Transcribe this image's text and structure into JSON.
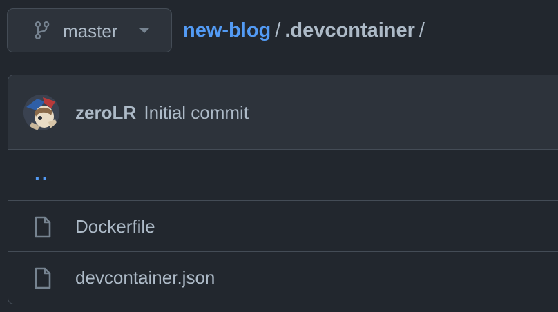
{
  "branch": {
    "label": "master",
    "icon": "git-branch-icon"
  },
  "breadcrumb": {
    "repo": "new-blog",
    "separator": "/",
    "current": ".devcontainer",
    "trailing": "/"
  },
  "commit": {
    "author": "zeroLR",
    "message": "Initial commit"
  },
  "parent_dir": {
    "label": ".."
  },
  "files": [
    {
      "name": "Dockerfile",
      "icon": "file-icon"
    },
    {
      "name": "devcontainer.json",
      "icon": "file-icon"
    }
  ],
  "colors": {
    "background": "#22272e",
    "header_bg": "#2d333b",
    "border": "#444c56",
    "link": "#539bf5",
    "text": "#adbac7"
  }
}
